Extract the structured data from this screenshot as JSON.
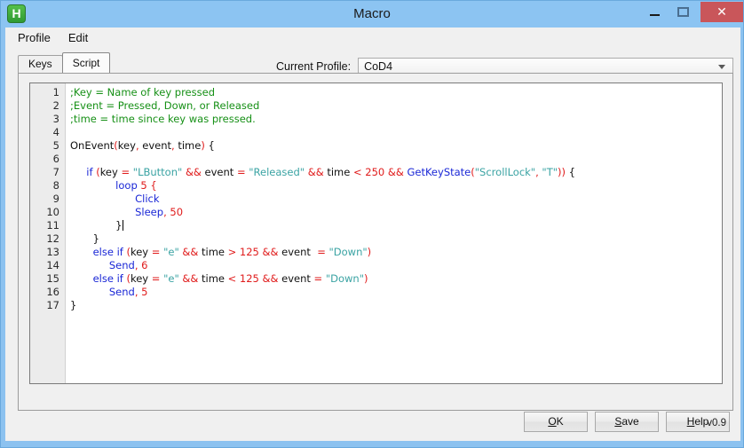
{
  "window": {
    "title": "Macro",
    "icon": "app-h-icon",
    "controls": {
      "minimize": "–",
      "maximize": "□",
      "close": "✕"
    }
  },
  "menubar": {
    "items": [
      {
        "label": "Profile"
      },
      {
        "label": "Edit"
      }
    ]
  },
  "tabs": [
    {
      "label": "Keys",
      "active": false
    },
    {
      "label": "Script",
      "active": true
    }
  ],
  "profile": {
    "label": "Current Profile:",
    "selected": "CoD4",
    "arrow_icon": "chevron-down-icon"
  },
  "editor": {
    "line_numbers": [
      "1",
      "2",
      "3",
      "4",
      "5",
      "6",
      "7",
      "8",
      "9",
      "10",
      "11",
      "12",
      "13",
      "14",
      "15",
      "16",
      "17"
    ],
    "lines": [
      {
        "n": 1,
        "tokens": [
          {
            "t": "com",
            "v": ";Key = Name of key pressed"
          }
        ]
      },
      {
        "n": 2,
        "tokens": [
          {
            "t": "com",
            "v": ";Event = Pressed, Down, or Released"
          }
        ]
      },
      {
        "n": 3,
        "tokens": [
          {
            "t": "com",
            "v": ";time = time since key was pressed."
          }
        ]
      },
      {
        "n": 4,
        "tokens": []
      },
      {
        "n": 5,
        "tokens": [
          {
            "t": "id",
            "v": "OnEvent"
          },
          {
            "t": "op",
            "v": "("
          },
          {
            "t": "id",
            "v": "key"
          },
          {
            "t": "op",
            "v": ","
          },
          {
            "t": "id",
            "v": " event"
          },
          {
            "t": "op",
            "v": ","
          },
          {
            "t": "id",
            "v": " time"
          },
          {
            "t": "op",
            "v": ")"
          },
          {
            "t": "id",
            "v": " {"
          }
        ]
      },
      {
        "n": 6,
        "tokens": []
      },
      {
        "n": 7,
        "tokens": [
          {
            "t": "kw",
            "v": "     if "
          },
          {
            "t": "op",
            "v": "("
          },
          {
            "t": "id",
            "v": "key "
          },
          {
            "t": "op",
            "v": "= "
          },
          {
            "t": "str",
            "v": "\"LButton\""
          },
          {
            "t": "op",
            "v": " && "
          },
          {
            "t": "id",
            "v": "event "
          },
          {
            "t": "op",
            "v": "= "
          },
          {
            "t": "str",
            "v": "\"Released\""
          },
          {
            "t": "op",
            "v": " && "
          },
          {
            "t": "id",
            "v": "time "
          },
          {
            "t": "op",
            "v": "< "
          },
          {
            "t": "num",
            "v": "250"
          },
          {
            "t": "op",
            "v": " && "
          },
          {
            "t": "fn",
            "v": "GetKeyState"
          },
          {
            "t": "op",
            "v": "("
          },
          {
            "t": "str",
            "v": "\"ScrollLock\""
          },
          {
            "t": "op",
            "v": ", "
          },
          {
            "t": "str",
            "v": "\"T\""
          },
          {
            "t": "op",
            "v": "))"
          },
          {
            "t": "id",
            "v": " {"
          }
        ]
      },
      {
        "n": 8,
        "tokens": [
          {
            "t": "kw",
            "v": "              loop "
          },
          {
            "t": "num",
            "v": "5"
          },
          {
            "t": "op",
            "v": " {"
          }
        ]
      },
      {
        "n": 9,
        "tokens": [
          {
            "t": "kw",
            "v": "                    Click"
          }
        ]
      },
      {
        "n": 10,
        "tokens": [
          {
            "t": "kw",
            "v": "                    Sleep"
          },
          {
            "t": "op",
            "v": ", "
          },
          {
            "t": "num",
            "v": "50"
          }
        ]
      },
      {
        "n": 11,
        "tokens": [
          {
            "t": "id",
            "v": "              }"
          },
          {
            "t": "caret",
            "v": ""
          }
        ]
      },
      {
        "n": 12,
        "tokens": [
          {
            "t": "id",
            "v": "       }"
          }
        ]
      },
      {
        "n": 13,
        "tokens": [
          {
            "t": "kw",
            "v": "       else if "
          },
          {
            "t": "op",
            "v": "("
          },
          {
            "t": "id",
            "v": "key "
          },
          {
            "t": "op",
            "v": "= "
          },
          {
            "t": "str",
            "v": "\"e\""
          },
          {
            "t": "op",
            "v": " && "
          },
          {
            "t": "id",
            "v": "time "
          },
          {
            "t": "op",
            "v": "> "
          },
          {
            "t": "num",
            "v": "125"
          },
          {
            "t": "op",
            "v": " && "
          },
          {
            "t": "id",
            "v": "event  "
          },
          {
            "t": "op",
            "v": "= "
          },
          {
            "t": "str",
            "v": "\"Down\""
          },
          {
            "t": "op",
            "v": ")"
          }
        ]
      },
      {
        "n": 14,
        "tokens": [
          {
            "t": "kw",
            "v": "            Send"
          },
          {
            "t": "op",
            "v": ", "
          },
          {
            "t": "num",
            "v": "6"
          }
        ]
      },
      {
        "n": 15,
        "tokens": [
          {
            "t": "kw",
            "v": "       else if "
          },
          {
            "t": "op",
            "v": "("
          },
          {
            "t": "id",
            "v": "key "
          },
          {
            "t": "op",
            "v": "= "
          },
          {
            "t": "str",
            "v": "\"e\""
          },
          {
            "t": "op",
            "v": " && "
          },
          {
            "t": "id",
            "v": "time "
          },
          {
            "t": "op",
            "v": "< "
          },
          {
            "t": "num",
            "v": "125"
          },
          {
            "t": "op",
            "v": " && "
          },
          {
            "t": "id",
            "v": "event "
          },
          {
            "t": "op",
            "v": "= "
          },
          {
            "t": "str",
            "v": "\"Down\""
          },
          {
            "t": "op",
            "v": ")"
          }
        ]
      },
      {
        "n": 16,
        "tokens": [
          {
            "t": "kw",
            "v": "            Send"
          },
          {
            "t": "op",
            "v": ", "
          },
          {
            "t": "num",
            "v": "5"
          }
        ]
      },
      {
        "n": 17,
        "tokens": [
          {
            "t": "id",
            "v": "}"
          }
        ]
      }
    ]
  },
  "buttons": [
    {
      "name": "ok",
      "label": "OK",
      "accel": "O"
    },
    {
      "name": "save",
      "label": "Save",
      "accel": "S"
    },
    {
      "name": "help",
      "label": "Help",
      "accel": "H"
    }
  ],
  "version": "v0.9",
  "colors": {
    "titlebar": "#8cc4f2",
    "close_button": "#c9565a",
    "comment": "#169016",
    "keyword": "#1a27d6",
    "operator": "#e01b1b",
    "string": "#3aa3a3",
    "identifier": "#111111",
    "app_icon": "#3fa93f"
  }
}
